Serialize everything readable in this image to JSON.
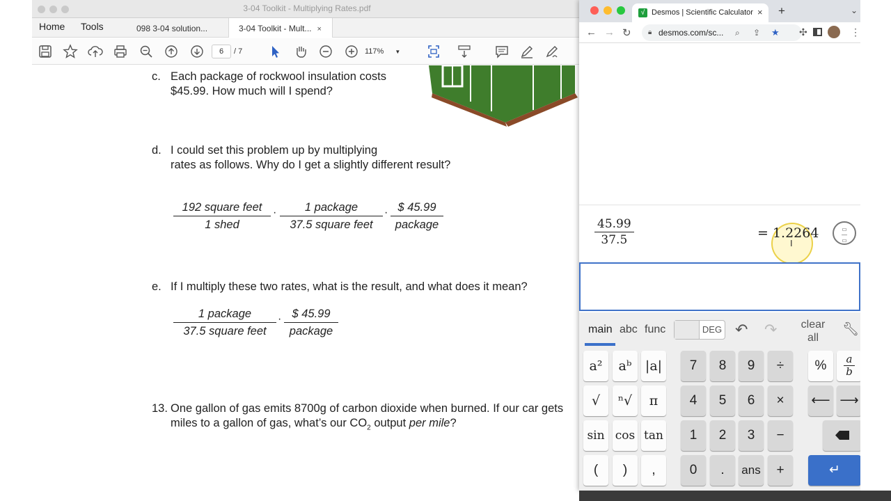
{
  "acrobat": {
    "window_title": "3-04 Toolkit - Multiplying Rates.pdf",
    "nav": {
      "home": "Home",
      "tools": "Tools"
    },
    "tabs": [
      {
        "label": "098 3-04 solution..."
      },
      {
        "label": "3-04 Toolkit - Mult...",
        "close": "×"
      }
    ],
    "toolbar": {
      "page_current": "6",
      "page_total": "/ 7",
      "zoom": "117%"
    }
  },
  "document": {
    "c": {
      "letter": "c.",
      "line1": "Each package of rockwool insulation costs",
      "line2": "$45.99.  How much will I spend?"
    },
    "d": {
      "letter": "d.",
      "line1": "I could set this problem up by multiplying",
      "line2": "rates as follows.  Why do I get a slightly different result?",
      "fractions": [
        {
          "num": "192 square feet",
          "den": "1 shed"
        },
        {
          "num": "1 package",
          "den": "37.5 square feet"
        },
        {
          "num": "$ 45.99",
          "den": "package"
        }
      ],
      "dot": "·"
    },
    "e": {
      "letter": "e.",
      "line1": "If I multiply these two rates, what is the result, and what does it mean?",
      "fractions": [
        {
          "num": "1 package",
          "den": "37.5 square feet"
        },
        {
          "num": "$ 45.99",
          "den": "package"
        }
      ]
    },
    "q13": {
      "number": "13.",
      "line1": "One gallon of gas emits 8700g of carbon dioxide when burned.  If our car gets",
      "line2_a": "miles to a gallon of gas, what’s our CO",
      "line2_sub": "2",
      "line2_b": " output ",
      "line2_em": "per mile",
      "line2_c": "?"
    }
  },
  "browser": {
    "tab_title": "Desmos | Scientific Calculator",
    "tab_close": "×",
    "new_tab": "+",
    "url": "desmos.com/sc..."
  },
  "desmos": {
    "expr1": {
      "num": "45.99",
      "den": "37.5",
      "result": "= 1.2264"
    },
    "keypad_tabs": {
      "main": "main",
      "abc": "abc",
      "func": "func",
      "deg": "DEG",
      "clear_all_1": "clear",
      "clear_all_2": "all"
    },
    "keys": {
      "a2": "a²",
      "ab": "aᵇ",
      "abs": "|a|",
      "sqrt": "√",
      "nroot": "ⁿ√",
      "pi": "π",
      "sin": "sin",
      "cos": "cos",
      "tan": "tan",
      "lparen": "(",
      "rparen": ")",
      "comma": ",",
      "k7": "7",
      "k8": "8",
      "k9": "9",
      "div": "÷",
      "k4": "4",
      "k5": "5",
      "k6": "6",
      "mul": "×",
      "k1": "1",
      "k2": "2",
      "k3": "3",
      "minus": "−",
      "k0": "0",
      "dot": ".",
      "ans": "ans",
      "plus": "+",
      "percent": "%",
      "frac_a": "a",
      "frac_b": "b",
      "left": "⟵",
      "right": "⟶",
      "enter": "↵"
    }
  },
  "colors": {
    "accent_blue": "#3a70c9",
    "favicon_green": "#1e9e3c"
  }
}
